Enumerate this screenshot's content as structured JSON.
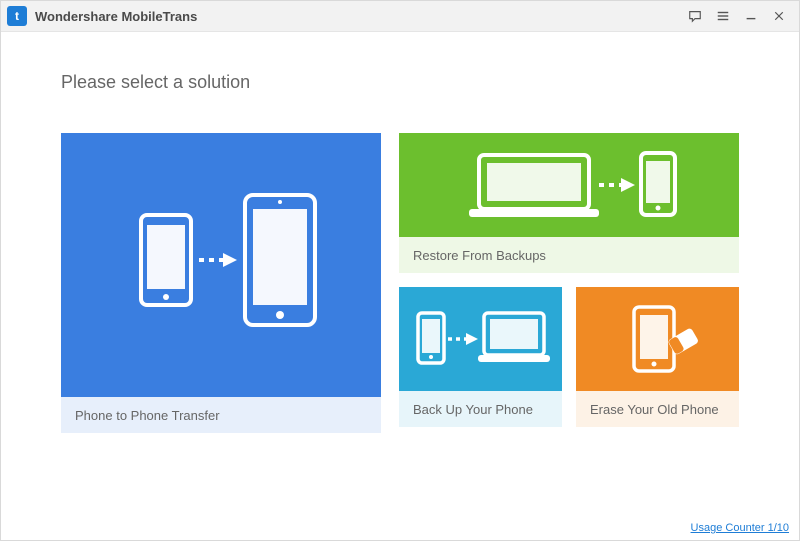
{
  "titlebar": {
    "app_name": "Wondershare MobileTrans"
  },
  "heading": "Please select a solution",
  "tiles": {
    "transfer": {
      "label": "Phone to Phone Transfer"
    },
    "restore": {
      "label": "Restore From Backups"
    },
    "backup": {
      "label": "Back Up Your Phone"
    },
    "erase": {
      "label": "Erase Your Old Phone"
    }
  },
  "footer": {
    "usage_counter": "Usage Counter 1/10"
  },
  "colors": {
    "blue": "#3a7ee0",
    "green": "#6cbf2e",
    "cyan": "#2aa8d6",
    "orange": "#f08a24"
  }
}
